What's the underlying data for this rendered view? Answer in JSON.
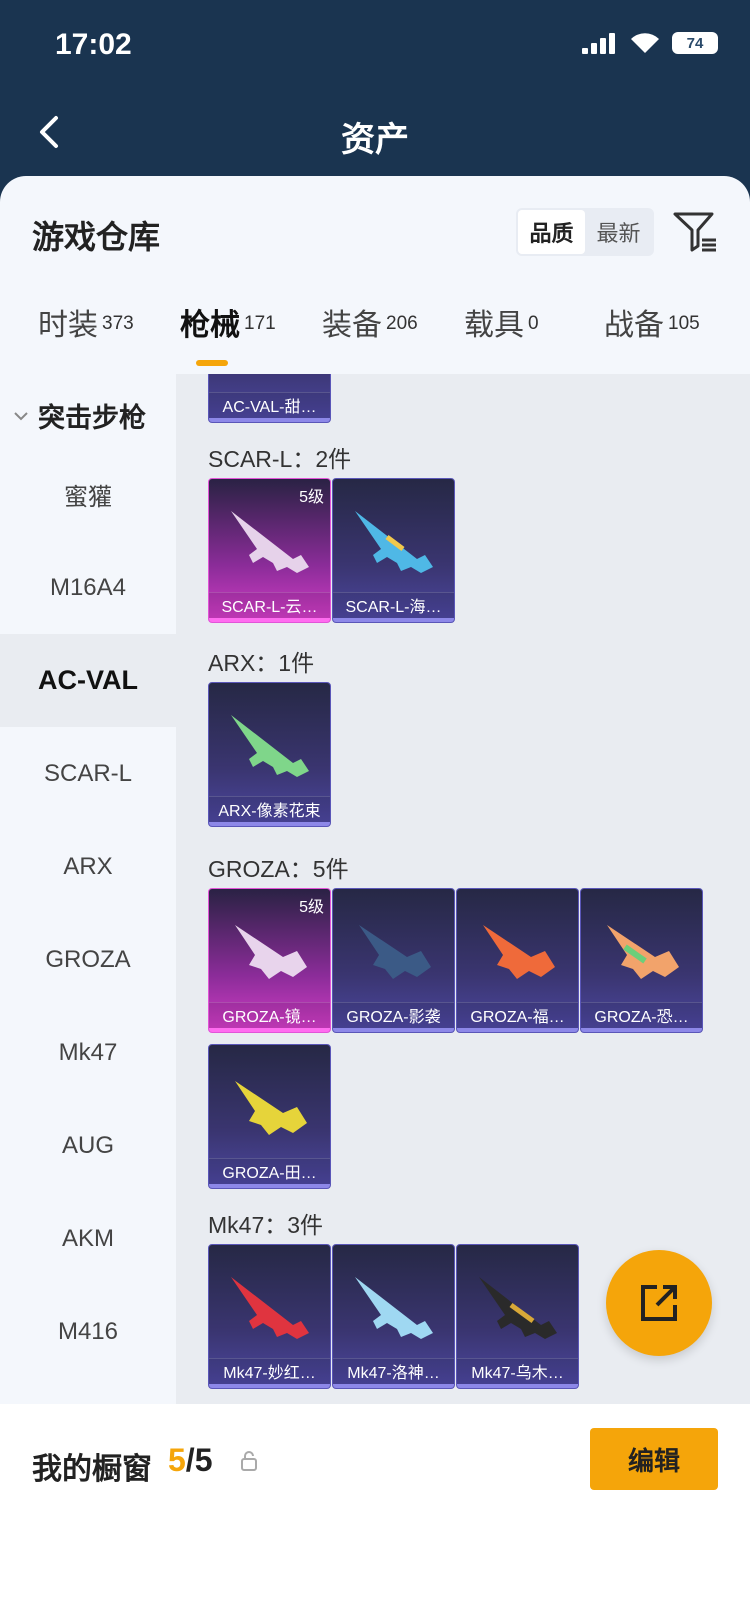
{
  "status": {
    "time": "17:02",
    "battery": "74"
  },
  "nav": {
    "title": "资产"
  },
  "sheet": {
    "title": "游戏仓库"
  },
  "sort": {
    "options": [
      "品质",
      "最新"
    ],
    "active": "品质"
  },
  "tabs": [
    {
      "label": "时装",
      "count": "373"
    },
    {
      "label": "枪械",
      "count": "171"
    },
    {
      "label": "装备",
      "count": "206"
    },
    {
      "label": "载具",
      "count": "0"
    },
    {
      "label": "战备",
      "count": "105"
    }
  ],
  "sidebar": {
    "group": "突击步枪",
    "items": [
      "蜜獾",
      "M16A4",
      "AC-VAL",
      "SCAR-L",
      "ARX",
      "GROZA",
      "Mk47",
      "AUG",
      "AKM",
      "M416"
    ],
    "active": "AC-VAL"
  },
  "groups": [
    {
      "title": "",
      "items": [
        {
          "name": "AC-VAL-甜…",
          "level": ""
        }
      ]
    },
    {
      "title": "SCAR-L：2件",
      "items": [
        {
          "name": "SCAR-L-云…",
          "level": "5级"
        },
        {
          "name": "SCAR-L-海…",
          "level": ""
        }
      ]
    },
    {
      "title": "ARX：1件",
      "items": [
        {
          "name": "ARX-像素花束",
          "level": ""
        }
      ]
    },
    {
      "title": "GROZA：5件",
      "items": [
        {
          "name": "GROZA-镜…",
          "level": "5级"
        },
        {
          "name": "GROZA-影袭",
          "level": ""
        },
        {
          "name": "GROZA-福…",
          "level": ""
        },
        {
          "name": "GROZA-恐…",
          "level": ""
        },
        {
          "name": "GROZA-田…",
          "level": ""
        }
      ]
    },
    {
      "title": "Mk47：3件",
      "items": [
        {
          "name": "Mk47-妙红…",
          "level": ""
        },
        {
          "name": "Mk47-洛神…",
          "level": ""
        },
        {
          "name": "Mk47-乌木…",
          "level": ""
        }
      ]
    }
  ],
  "colors": {
    "accent": "#f5a50a",
    "card_purple": "#3a3570",
    "card_legend": "#d23dc6"
  },
  "showcase": {
    "label": "我的橱窗",
    "current": "5",
    "total": "/5"
  },
  "edit_label": "编辑"
}
